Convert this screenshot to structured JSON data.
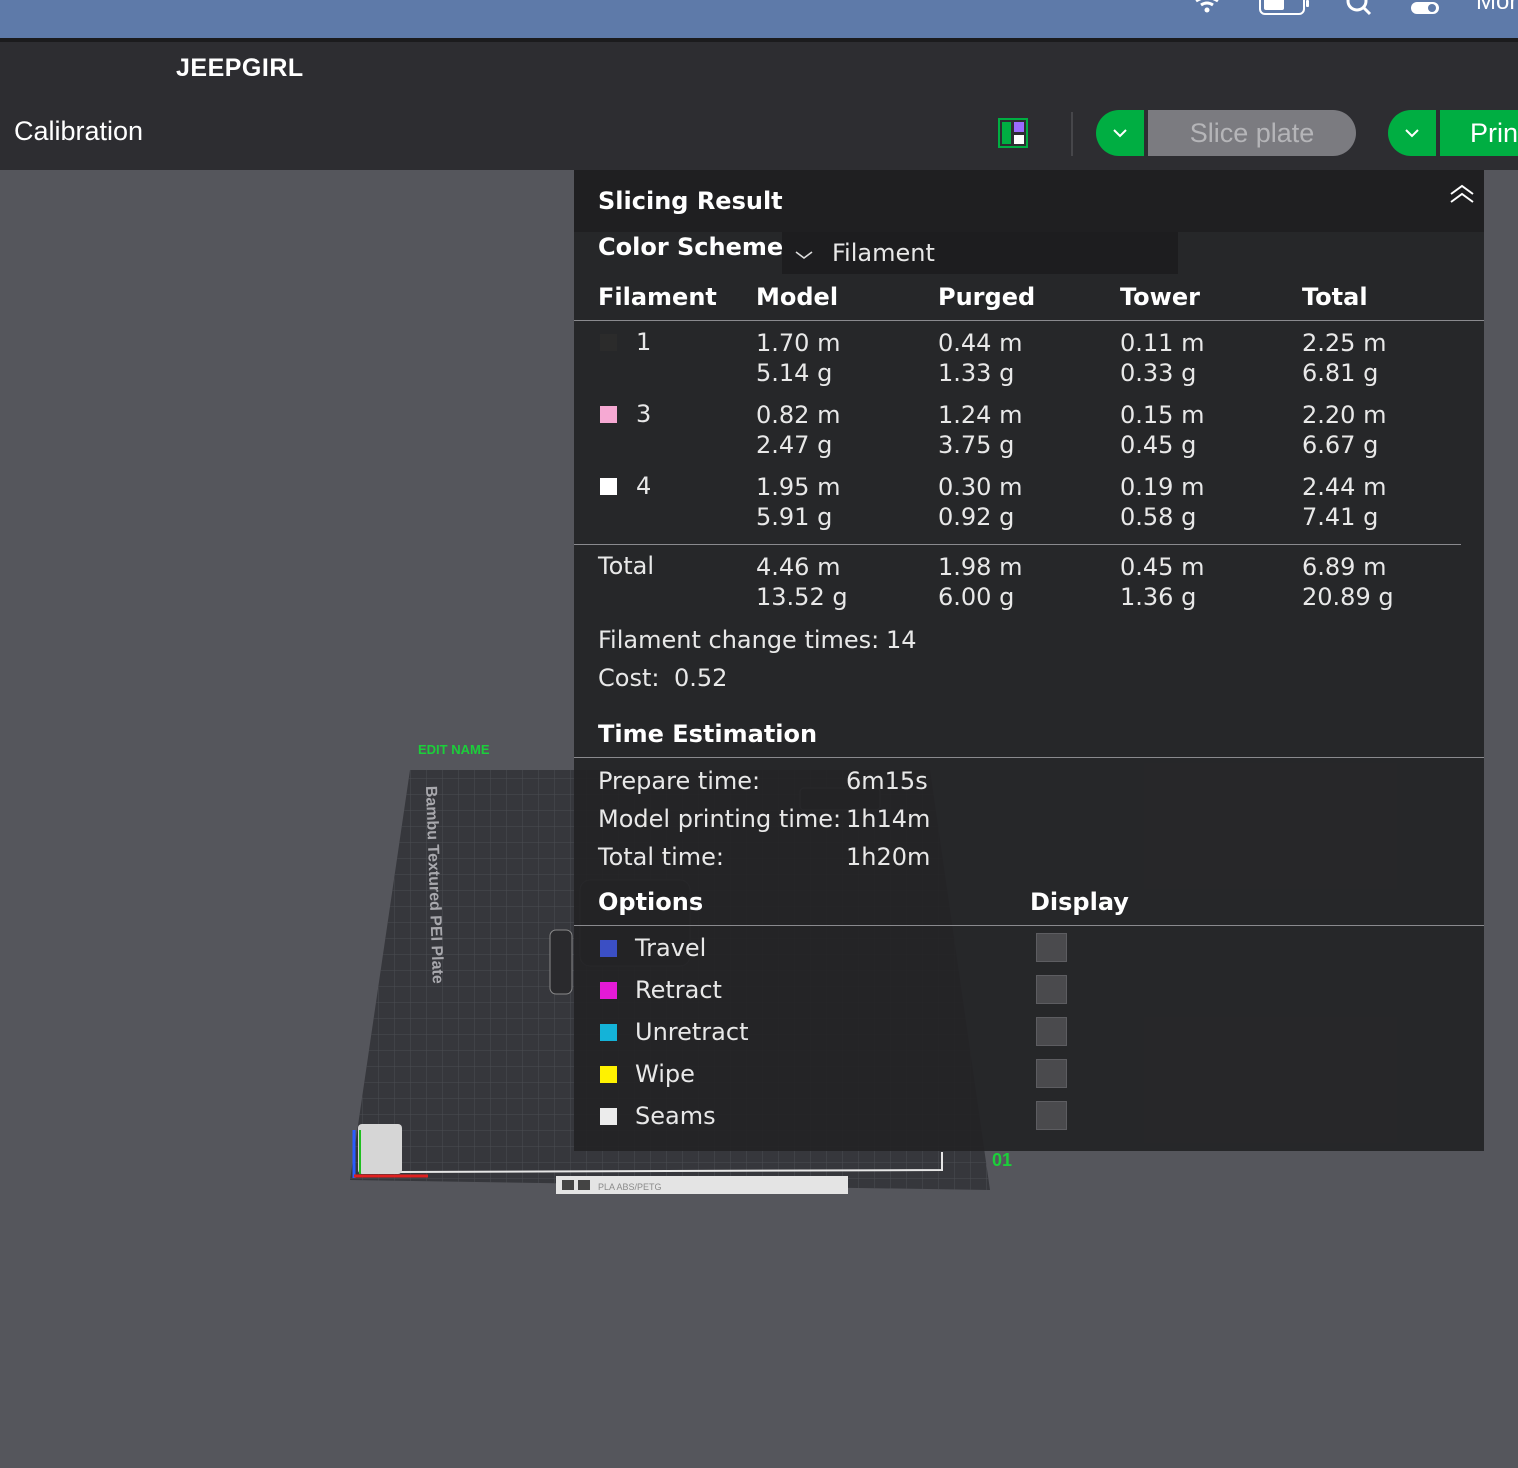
{
  "menubar": {
    "icons": [
      "wifi-icon",
      "battery-icon",
      "search-icon",
      "control-center-icon"
    ],
    "clock_partial": "Mor"
  },
  "app": {
    "project_title": "JEEPGIRL",
    "tab_calibration": "Calibration",
    "slice_button": "Slice plate",
    "print_button": "Prin"
  },
  "plate": {
    "edit_name": "EDIT NAME",
    "plate_label": "Bambu Textured PEI Plate",
    "plate_number": "01",
    "filament_strip": "PLA  ABS/PETG"
  },
  "panel": {
    "title": "Slicing Result",
    "color_scheme_label": "Color Scheme",
    "color_scheme_value": "Filament",
    "table": {
      "headers": [
        "Filament",
        "Model",
        "Purged",
        "Tower",
        "Total"
      ],
      "rows": [
        {
          "id": "1",
          "color": "#2b2b2b",
          "model_m": "1.70 m",
          "model_g": "5.14 g",
          "purged_m": "0.44 m",
          "purged_g": "1.33 g",
          "tower_m": "0.11 m",
          "tower_g": "0.33 g",
          "total_m": "2.25 m",
          "total_g": "6.81 g"
        },
        {
          "id": "3",
          "color": "#f6a9d3",
          "model_m": "0.82 m",
          "model_g": "2.47 g",
          "purged_m": "1.24 m",
          "purged_g": "3.75 g",
          "tower_m": "0.15 m",
          "tower_g": "0.45 g",
          "total_m": "2.20 m",
          "total_g": "6.67 g"
        },
        {
          "id": "4",
          "color": "#ffffff",
          "model_m": "1.95 m",
          "model_g": "5.91 g",
          "purged_m": "0.30 m",
          "purged_g": "0.92 g",
          "tower_m": "0.19 m",
          "tower_g": "0.58 g",
          "total_m": "2.44 m",
          "total_g": "7.41 g"
        }
      ],
      "total": {
        "label": "Total",
        "model_m": "4.46 m",
        "model_g": "13.52 g",
        "purged_m": "1.98 m",
        "purged_g": "6.00 g",
        "tower_m": "0.45 m",
        "tower_g": "1.36 g",
        "total_m": "6.89 m",
        "total_g": "20.89 g"
      }
    },
    "filament_change_label": "Filament change times:",
    "filament_change_value": "14",
    "cost_label": "Cost:",
    "cost_value": "0.52",
    "time_title": "Time Estimation",
    "prepare_label": "Prepare time:",
    "prepare_value": "6m15s",
    "model_time_label": "Model printing time:",
    "model_time_value": "1h14m",
    "total_time_label": "Total time:",
    "total_time_value": "1h20m",
    "options_title": "Options",
    "display_title": "Display",
    "options": [
      {
        "label": "Travel",
        "color": "#3b4fc4"
      },
      {
        "label": "Retract",
        "color": "#e41ad6"
      },
      {
        "label": "Unretract",
        "color": "#14b3d8"
      },
      {
        "label": "Wipe",
        "color": "#fff200"
      },
      {
        "label": "Seams",
        "color": "#ececec"
      }
    ]
  },
  "colors": {
    "accent_green": "#00ae42",
    "panel_bg": "#232325",
    "toolbar_bg": "#2d2d31",
    "viewport_bg": "#55565c"
  }
}
